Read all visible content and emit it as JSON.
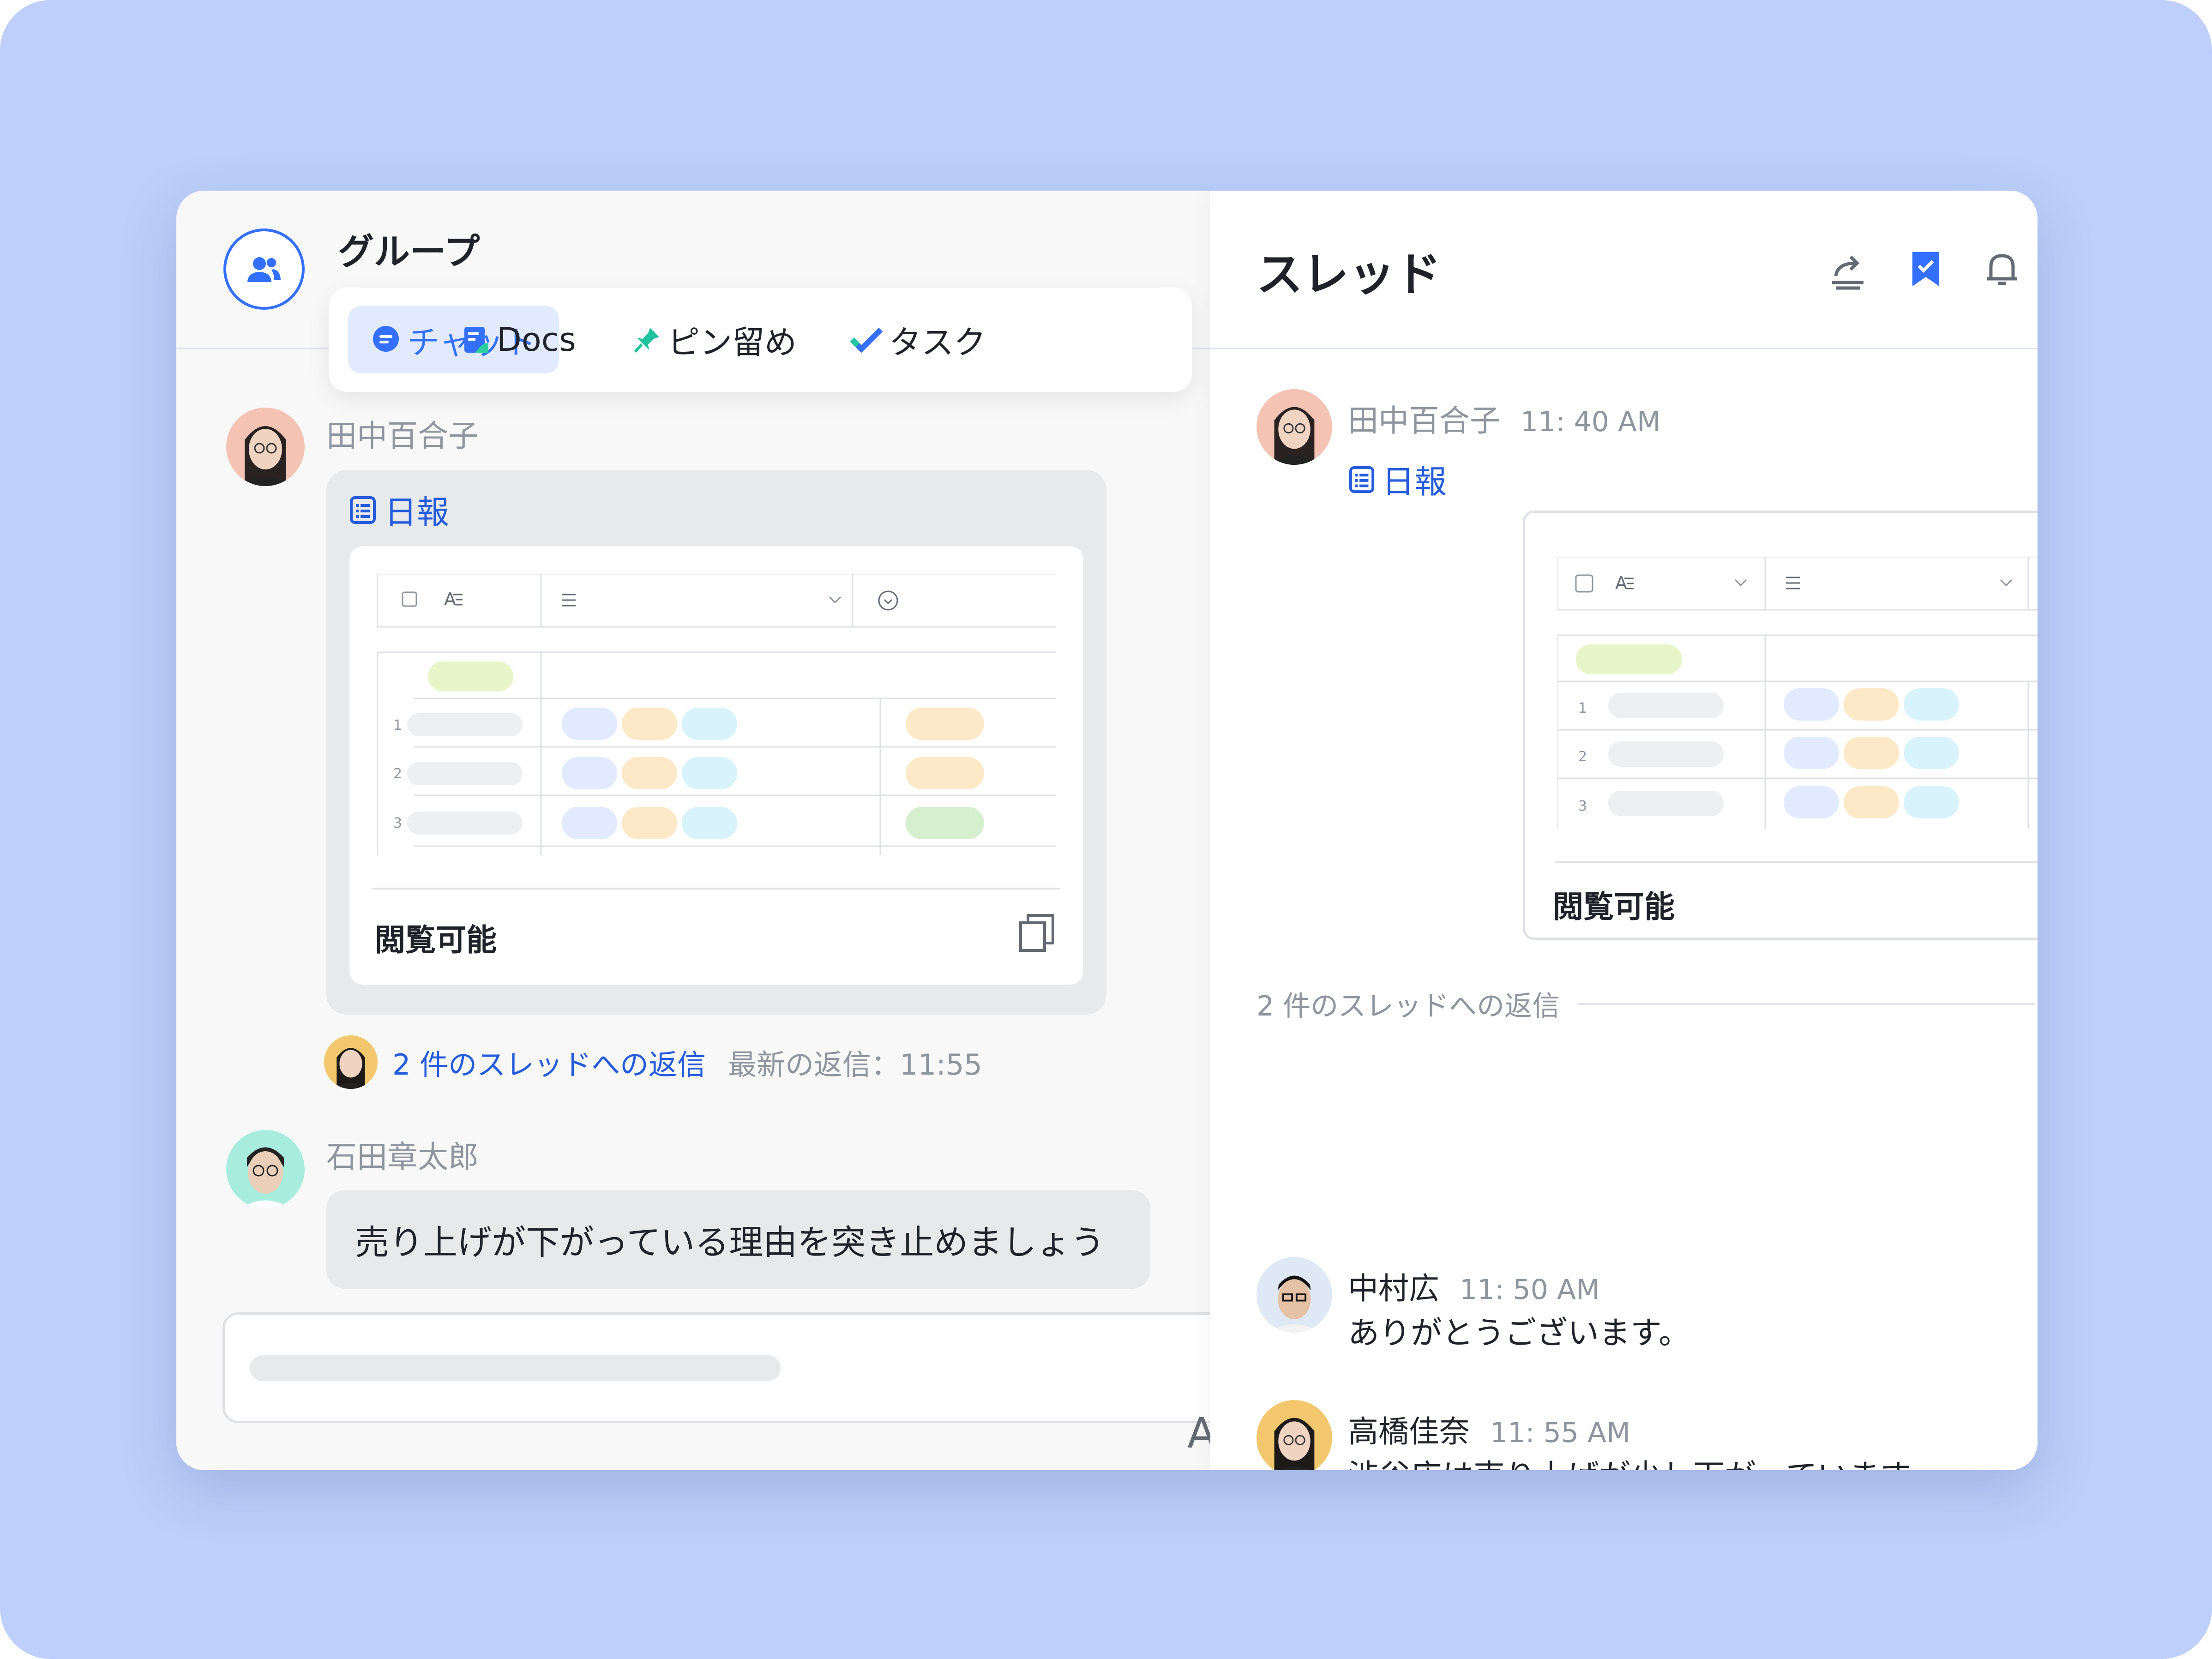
{
  "left": {
    "group_title": "グループ",
    "tabs": [
      {
        "label": "チャット",
        "icon": "chat-icon",
        "active": true
      },
      {
        "label": "Docs",
        "icon": "docs-icon"
      },
      {
        "label": "ピン留め",
        "icon": "pin-icon"
      },
      {
        "label": "タスク",
        "icon": "task-icon"
      }
    ],
    "messages": [
      {
        "sender": "田中百合子",
        "doc_title": "日報",
        "permission": "閲覧可能",
        "row_numbers": [
          "1",
          "2",
          "3"
        ],
        "reply_text": "2 件のスレッドへの返信",
        "latest_reply": "最新の返信：11:55"
      },
      {
        "sender": "石田章太郎",
        "text": "売り上げが下がっている理由を突き止めましょう"
      }
    ],
    "input_glyph": "A"
  },
  "thread": {
    "title": "スレッド",
    "icons": [
      "share-icon",
      "bookmark-icon",
      "bell-icon",
      "close-icon"
    ],
    "root": {
      "sender": "田中百合子",
      "time": "11: 40 AM",
      "doc_title": "日報",
      "permission": "閲覧可能",
      "row_numbers": [
        "1",
        "2",
        "3"
      ]
    },
    "reply_count_label": "2 件のスレッドへの返信",
    "replies": [
      {
        "sender": "中村広",
        "time": "11: 50 AM",
        "text": "ありがとうございます。"
      },
      {
        "sender": "高橋佳奈",
        "time": "11: 55 AM",
        "text": "渋谷店は売り上げが少し下がっていますね。"
      }
    ]
  },
  "colors": {
    "background": "#bdcffa",
    "accent": "#3370ff",
    "link": "#245bdb",
    "pill_blue": "#e1eaff",
    "pill_orange": "#fde9c8",
    "pill_cyan": "#d9f3fd",
    "pill_green": "#d5efcf",
    "pill_lime": "#e8f5c9"
  }
}
